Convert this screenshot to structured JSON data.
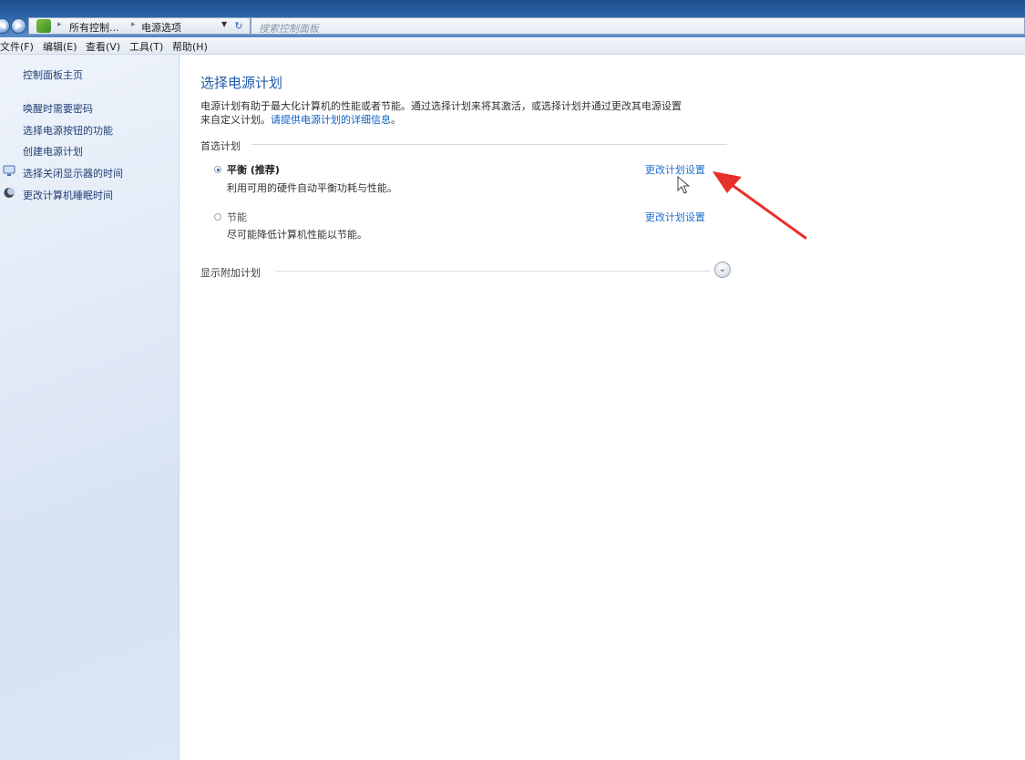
{
  "addressbar": {
    "breadcrumbs": [
      "所有控制...",
      "电源选项"
    ],
    "search_placeholder": "搜索控制面板"
  },
  "menubar": {
    "items": [
      "文件(F)",
      "编辑(E)",
      "查看(V)",
      "工具(T)",
      "帮助(H)"
    ]
  },
  "sidebar": {
    "home": "控制面板主页",
    "links": [
      "唤醒时需要密码",
      "选择电源按钮的功能",
      "创建电源计划",
      "选择关闭显示器的时间",
      "更改计算机睡眠时间"
    ]
  },
  "main": {
    "title": "选择电源计划",
    "description_line1": "电源计划有助于最大化计算机的性能或者节能。通过选择计划来将其激活，或选择计划并通过更改其电源设置",
    "description_line2_prefix": "来自定义计划。",
    "description_link": "请提供电源计划的详细信息",
    "description_line2_suffix": "。",
    "preferred_label": "首选计划",
    "plans": [
      {
        "name": "平衡 (推荐)",
        "description": "利用可用的硬件自动平衡功耗与性能。",
        "link": "更改计划设置",
        "selected": true
      },
      {
        "name": "节能",
        "description": "尽可能降低计算机性能以节能。",
        "link": "更改计划设置",
        "selected": false
      }
    ],
    "additional_label": "显示附加计划"
  },
  "colors": {
    "link": "#1f6fd1",
    "title": "#1e5aa8",
    "annotation_arrow": "#e8302a"
  }
}
